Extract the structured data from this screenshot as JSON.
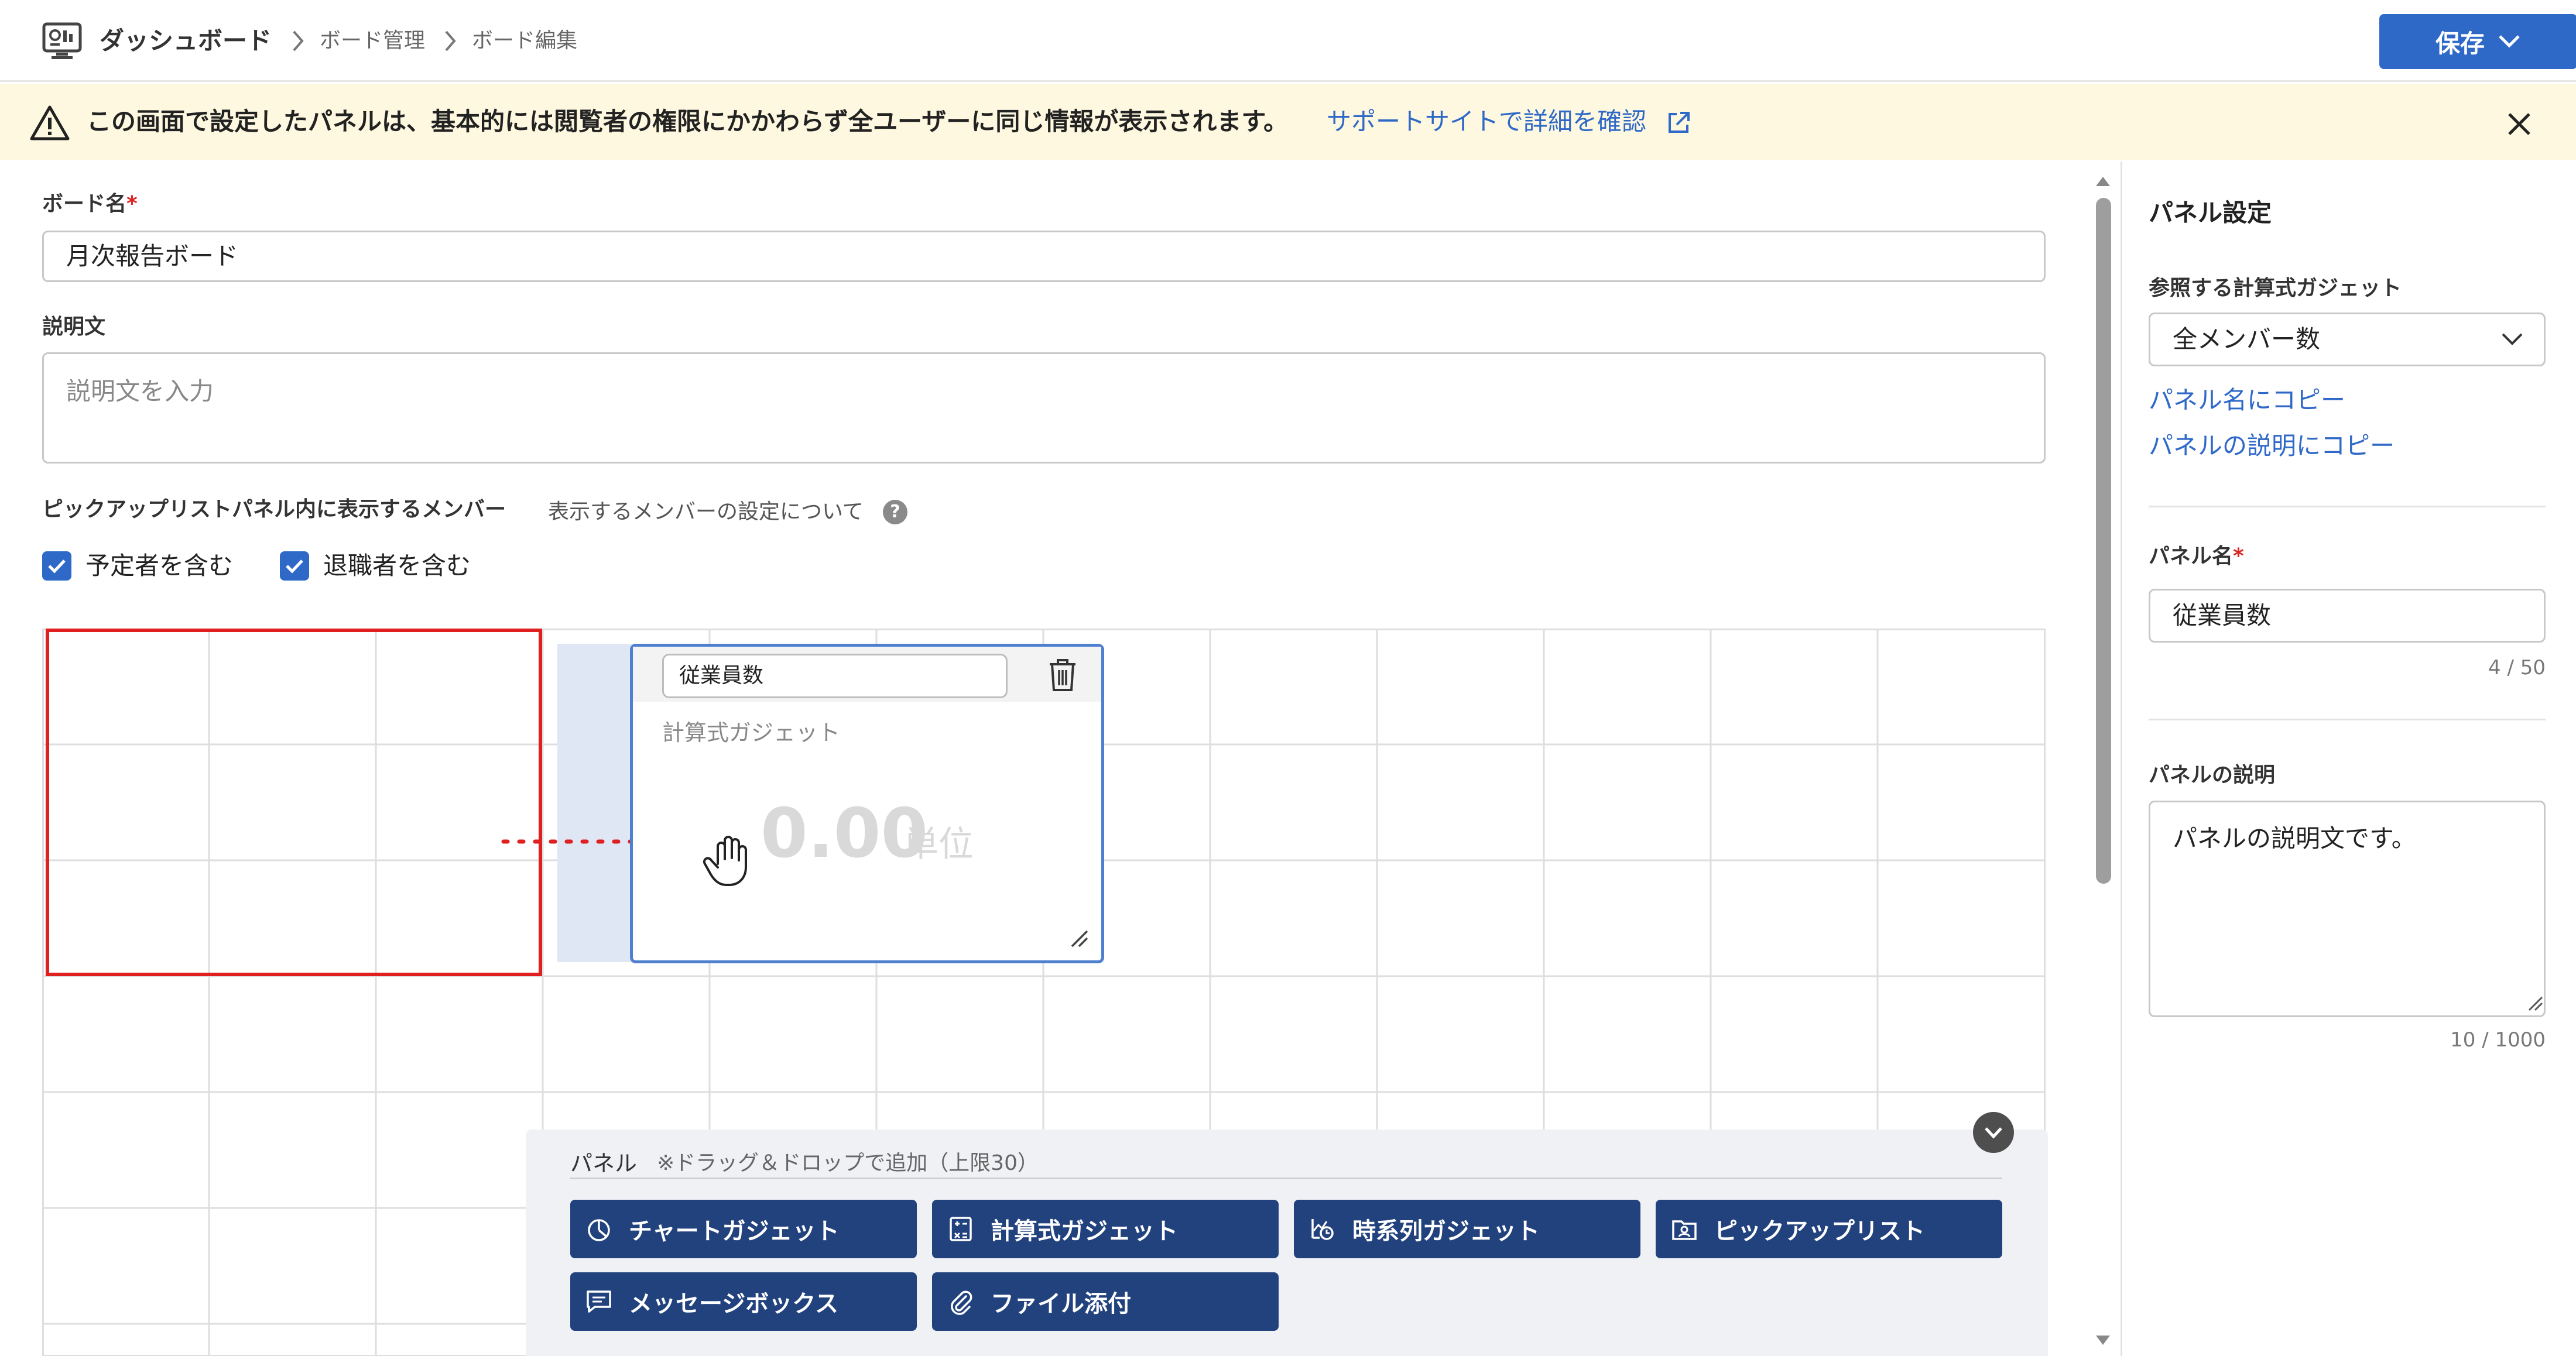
{
  "header": {
    "title": "ダッシュボード",
    "breadcrumbs": [
      "ボード管理",
      "ボード編集"
    ],
    "save_label": "保存"
  },
  "warning": {
    "message": "この画面で設定したパネルは、基本的には閲覧者の権限にかかわらず全ユーザーに同じ情報が表示されます。",
    "link_label": "サポートサイトで詳細を確認"
  },
  "form": {
    "board_name_label": "ボード名",
    "required_mark": "*",
    "board_name_value": "月次報告ボード",
    "description_label": "説明文",
    "description_placeholder": "説明文を入力",
    "members_label": "ピックアップリストパネル内に表示するメンバー",
    "members_help_text": "表示するメンバーの設定について",
    "help_glyph": "?",
    "include_scheduled_label": "予定者を含む",
    "include_retired_label": "退職者を含む",
    "include_scheduled_checked": true,
    "include_retired_checked": true
  },
  "panel_card": {
    "name_value": "従業員数",
    "type_label": "計算式ガジェット",
    "value": "0.00",
    "unit": "単位"
  },
  "palette": {
    "title": "パネル",
    "note": "※ドラッグ＆ドロップで追加（上限30）",
    "buttons": [
      {
        "label": "チャートガジェット",
        "icon": "chart-icon"
      },
      {
        "label": "計算式ガジェット",
        "icon": "calculator-icon"
      },
      {
        "label": "時系列ガジェット",
        "icon": "timeseries-icon"
      },
      {
        "label": "ピックアップリスト",
        "icon": "pickup-list-icon"
      },
      {
        "label": "メッセージボックス",
        "icon": "message-icon"
      },
      {
        "label": "ファイル添付",
        "icon": "paperclip-icon"
      }
    ]
  },
  "right_panel": {
    "title": "パネル設定",
    "gadget_ref_label": "参照する計算式ガジェット",
    "gadget_ref_value": "全メンバー数",
    "copy_to_name": "パネル名にコピー",
    "copy_to_description": "パネルの説明にコピー",
    "panel_name_label": "パネル名",
    "required_mark": "*",
    "panel_name_value": "従業員数",
    "panel_name_counter": "4 / 50",
    "panel_desc_label": "パネルの説明",
    "panel_desc_value": "パネルの説明文です。",
    "panel_desc_counter": "10 / 1000"
  },
  "colors": {
    "accent": "#2f69c8",
    "palette_button": "#22427e",
    "warning_bg": "#fdf8df",
    "highlight_border": "#e02020"
  }
}
